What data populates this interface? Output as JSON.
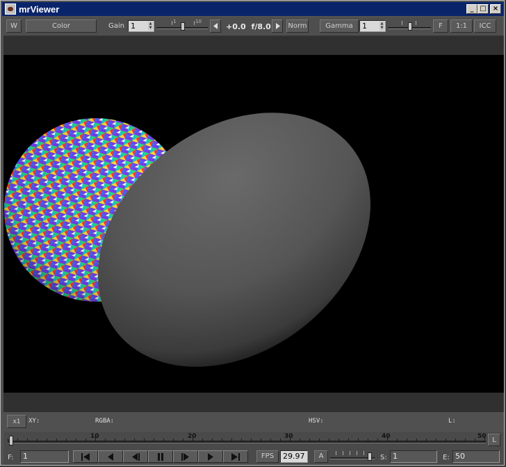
{
  "window": {
    "title": "mrViewer",
    "controls": {
      "minimize": "_",
      "maximize": "□",
      "close": "×"
    }
  },
  "toolbar": {
    "wipe_label": "W",
    "channel_label": "Color",
    "gain_label": "Gain",
    "gain_value": "1",
    "gain_ticks": [
      "1",
      "10"
    ],
    "gain_level": 0.5,
    "fstop_value": "+0.0",
    "fstop_label": "f/8.0",
    "normalize_label": "Norm",
    "gamma_label": "Gamma",
    "gamma_value": "1",
    "gamma_level": 0.5,
    "fit_label": "F",
    "one_to_one_label": "1:1",
    "icc_label": "ICC"
  },
  "status": {
    "zoom_label": "x1",
    "xy_label": "XY:",
    "rgba_label": "RGBA:",
    "hsv_label": "HSV:",
    "l_label": "L:"
  },
  "timeline": {
    "ticks": [
      "10",
      "20",
      "30",
      "40",
      "50"
    ],
    "start": 1,
    "end": 50,
    "current_frame": 1,
    "loop_label": "L"
  },
  "controls": {
    "frame_label": "F:",
    "frame_value": "1",
    "fps_label": "FPS",
    "fps_value": "29.97",
    "audio_label": "A",
    "volume_level": 0.92,
    "start_label": "S:",
    "start_value": "1",
    "end_label": "E:",
    "end_value": "50"
  },
  "colors": {
    "title_bar": "#0a246a",
    "viewport": "#000000",
    "panel": "#4a4a4a"
  },
  "icons": {
    "app": "mrviewer-app-icon",
    "first": "skip-to-start-icon",
    "prev": "step-back-icon",
    "play_back": "play-backward-icon",
    "stop": "stop-icon",
    "play_fwd": "play-forward-icon",
    "next": "step-forward-icon",
    "last": "skip-to-end-icon"
  }
}
